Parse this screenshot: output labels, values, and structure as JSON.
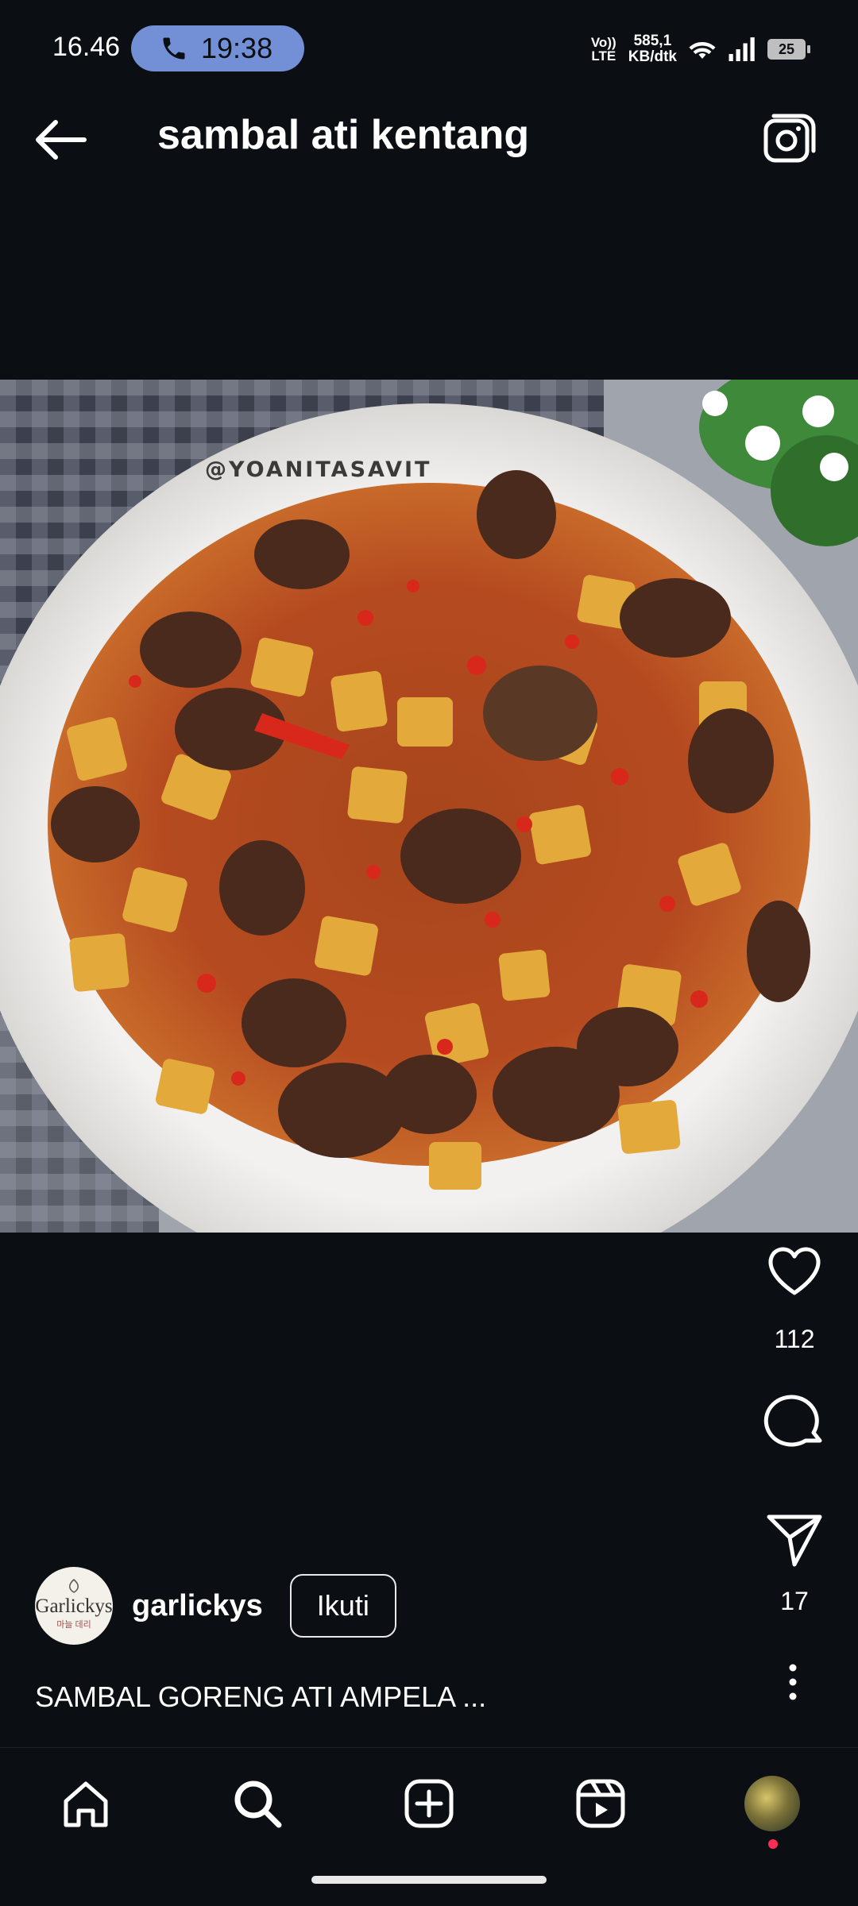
{
  "status_bar": {
    "time": "16.46",
    "call_duration": "19:38",
    "network_type": "Vo)) LTE",
    "speed_value": "585,1",
    "speed_unit": "KB/dtk",
    "battery": "25",
    "icons": [
      "phone-icon",
      "wifi-icon",
      "signal-icon",
      "battery-icon"
    ]
  },
  "header": {
    "title": "sambal ati kentang",
    "back_icon": "back-arrow-icon",
    "camera_icon": "camera-icon"
  },
  "post": {
    "image_watermark": "@YOANITASAVIT",
    "likes": "112",
    "shares": "17",
    "author": {
      "username": "garlickys",
      "avatar_text": "Garlickys",
      "avatar_subtext": "마늘 데리",
      "follow_label": "Ikuti"
    },
    "caption": "SAMBAL GORENG ATI AMPELA ..."
  },
  "bottom_nav": {
    "items": [
      "home-icon",
      "search-icon",
      "add-icon",
      "reels-icon",
      "profile-avatar"
    ]
  },
  "colors": {
    "background": "#0b0e13",
    "call_pill": "#7390d6",
    "notification_dot": "#ff2d55"
  }
}
